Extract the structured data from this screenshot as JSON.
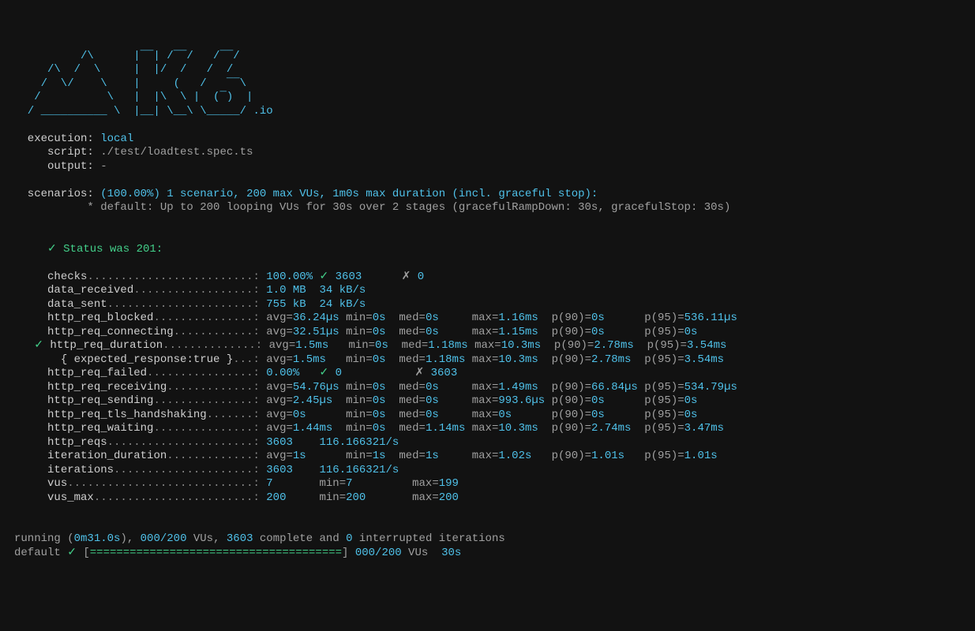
{
  "logo": "          /\\      |‾‾| /‾‾/   /‾‾/   \n     /\\  /  \\     |  |/  /   /  /    \n    /  \\/    \\    |     (   /   ‾‾\\  \n   /          \\   |  |\\  \\ |  (‾)  | \n  / __________ \\  |__| \\__\\ \\_____/ .io",
  "header": {
    "executionLabel": "  execution:",
    "executionValue": "local",
    "scriptLabel": "     script:",
    "scriptValue": "./test/loadtest.spec.ts",
    "outputLabel": "     output:",
    "outputValue": "-",
    "scenariosLabel": "  scenarios:",
    "scenariosValue": "(100.00%) 1 scenario, 200 max VUs, 1m0s max duration (incl. graceful stop):",
    "scenarioDetail": "           * default: Up to 200 looping VUs for 30s over 2 stages (gracefulRampDown: 30s, gracefulStop: 30s)"
  },
  "status": {
    "mark": "✓",
    "text": "Status was 201:"
  },
  "metrics": {
    "checks": {
      "name": "checks",
      "dots": ".........................:",
      "pct": "100.00%",
      "mark": "✓",
      "pass": "3603",
      "fail_mark": "✗",
      "fail": "0"
    },
    "data_received": {
      "name": "data_received",
      "dots": "..................:",
      "v1": "1.0 MB",
      "v2": "34 kB/s"
    },
    "data_sent": {
      "name": "data_sent",
      "dots": "......................:",
      "v1": "755 kB",
      "v2": "24 kB/s"
    },
    "rows": [
      {
        "mark": "",
        "name": "http_req_blocked",
        "dots": "...............:",
        "avg": "36.24µs",
        "min": "0s",
        "med": "0s",
        "max": "1.16ms",
        "p90": "0s",
        "p95": "536.11µs"
      },
      {
        "mark": "",
        "name": "http_req_connecting",
        "dots": "............:",
        "avg": "32.51µs",
        "min": "0s",
        "med": "0s",
        "max": "1.15ms",
        "p90": "0s",
        "p95": "0s"
      },
      {
        "mark": "✓",
        "name": "http_req_duration",
        "dots": "..............:",
        "avg": "1.5ms",
        "min": "0s",
        "med": "1.18ms",
        "max": "10.3ms",
        "p90": "2.78ms",
        "p95": "3.54ms"
      },
      {
        "mark": "",
        "name": "  { expected_response:true }",
        "dots": "...:",
        "avg": "1.5ms",
        "min": "0s",
        "med": "1.18ms",
        "max": "10.3ms",
        "p90": "2.78ms",
        "p95": "3.54ms"
      },
      {
        "special": "failed",
        "name": "http_req_failed",
        "dots": "................:",
        "pct": "0.00%",
        "pass_mark": "✓",
        "pass": "0",
        "fail_mark": "✗",
        "fail": "3603"
      },
      {
        "mark": "",
        "name": "http_req_receiving",
        "dots": ".............:",
        "avg": "54.76µs",
        "min": "0s",
        "med": "0s",
        "max": "1.49ms",
        "p90": "66.84µs",
        "p95": "534.79µs"
      },
      {
        "mark": "",
        "name": "http_req_sending",
        "dots": "...............:",
        "avg": "2.45µs",
        "min": "0s",
        "med": "0s",
        "max": "993.6µs",
        "p90": "0s",
        "p95": "0s"
      },
      {
        "mark": "",
        "name": "http_req_tls_handshaking",
        "dots": ".......:",
        "avg": "0s",
        "min": "0s",
        "med": "0s",
        "max": "0s",
        "p90": "0s",
        "p95": "0s"
      },
      {
        "mark": "",
        "name": "http_req_waiting",
        "dots": "...............:",
        "avg": "1.44ms",
        "min": "0s",
        "med": "1.14ms",
        "max": "10.3ms",
        "p90": "2.74ms",
        "p95": "3.47ms"
      },
      {
        "special": "reqs",
        "name": "http_reqs",
        "dots": "......................:",
        "v1": "3603",
        "v2": "116.166321/s"
      },
      {
        "mark": "",
        "name": "iteration_duration",
        "dots": ".............:",
        "avg": "1s",
        "min": "1s",
        "med": "1s",
        "max": "1.02s",
        "p90": "1.01s",
        "p95": "1.01s"
      },
      {
        "special": "reqs",
        "name": "iterations",
        "dots": ".....................:",
        "v1": "3603",
        "v2": "116.166321/s"
      },
      {
        "special": "vus",
        "name": "vus",
        "dots": "............................:",
        "v1": "7",
        "min": "7",
        "max": "199"
      },
      {
        "special": "vus",
        "name": "vus_max",
        "dots": "........................:",
        "v1": "200",
        "min": "200",
        "max": "200"
      }
    ]
  },
  "footer": {
    "line1_a": "running (",
    "line1_time": "0m31.0s",
    "line1_b": "), ",
    "line1_vus": "000/200",
    "line1_c": " VUs, ",
    "line1_complete": "3603",
    "line1_d": " complete and ",
    "line1_int": "0",
    "line1_e": " interrupted iterations",
    "line2_a": "default ",
    "line2_mark": "✓",
    "line2_b": " [",
    "line2_bar": "======================================",
    "line2_c": "] ",
    "line2_vus": "000/200",
    "line2_d": " VUs  ",
    "line2_dur": "30s"
  }
}
